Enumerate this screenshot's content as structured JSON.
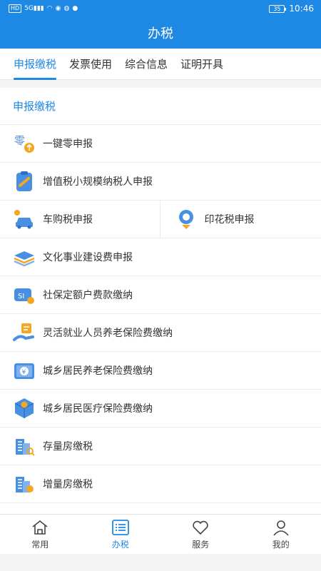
{
  "status_bar": {
    "left": [
      "HD",
      "5G",
      "all",
      "wifi",
      "shield",
      "weibo",
      "chat"
    ],
    "battery": "35",
    "time": "10:46"
  },
  "app_bar": {
    "title": "办税"
  },
  "tabs": [
    {
      "label": "申报缴税",
      "active": true
    },
    {
      "label": "发票使用",
      "active": false
    },
    {
      "label": "综合信息",
      "active": false
    },
    {
      "label": "证明开具",
      "active": false
    }
  ],
  "section": {
    "title": "申报缴税"
  },
  "rows": {
    "zero": "一键零申报",
    "vat": "增值税小规模纳税人申报",
    "car": "车购税申报",
    "stamp": "印花税申报",
    "culture": "文化事业建设费申报",
    "social": "社保定额户费款缴纳",
    "flex": "灵活就业人员养老保险费缴纳",
    "pension": "城乡居民养老保险费缴纳",
    "medical": "城乡居民医疗保险费缴纳",
    "stock_house": "存量房缴税",
    "new_house": "增量房缴税"
  },
  "zero_icon_text": "零",
  "bottom_nav": [
    {
      "label": "常用",
      "icon": "home-icon"
    },
    {
      "label": "办税",
      "icon": "list-icon",
      "active": true
    },
    {
      "label": "服务",
      "icon": "heart-icon"
    },
    {
      "label": "我的",
      "icon": "user-icon"
    }
  ],
  "colors": {
    "primary": "#1e88e5",
    "orange": "#f5a623"
  }
}
